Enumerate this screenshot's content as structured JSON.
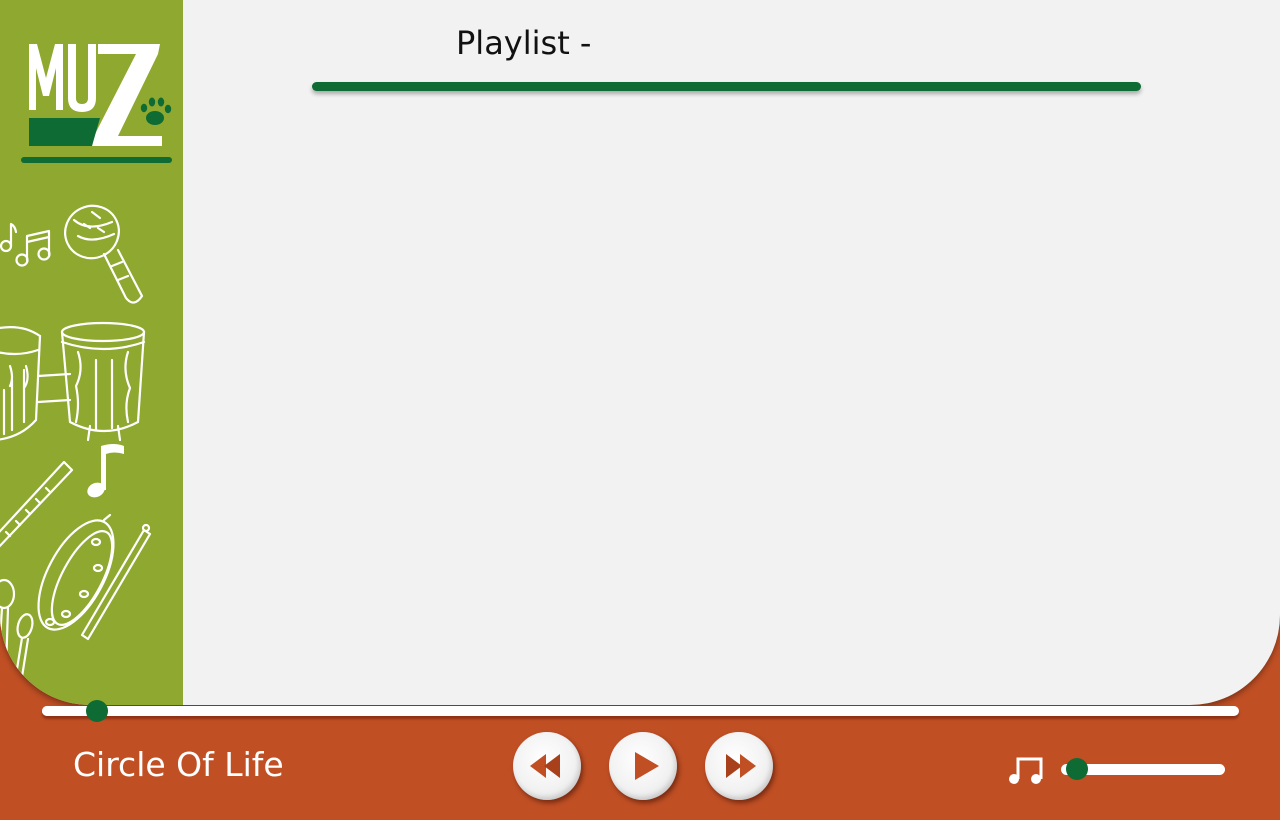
{
  "app": {
    "logo_text": "MUZ"
  },
  "playlist": {
    "title": "Playlist -"
  },
  "player": {
    "track_title": "Circle Of Life",
    "progress": 0.046,
    "volume": 0.1,
    "icons": {
      "previous": "rewind-icon",
      "play": "play-icon",
      "next": "fast-forward-icon",
      "volume": "music-note-icon"
    }
  },
  "colors": {
    "sidebar": "#8fa82f",
    "accent_green": "#0d6b33",
    "player_bar": "#c04f24",
    "panel": "#f2f2f2",
    "button_arrow": "#c04f24"
  }
}
